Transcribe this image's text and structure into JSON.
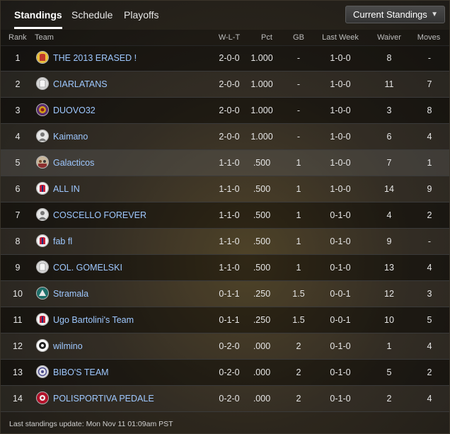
{
  "tabs": [
    {
      "label": "Standings"
    },
    {
      "label": "Schedule"
    },
    {
      "label": "Playoffs"
    }
  ],
  "view_select": {
    "selected": "Current Standings"
  },
  "columns": {
    "rank": "Rank",
    "team": "Team",
    "wlt": "W-L-T",
    "pct": "Pct",
    "gb": "GB",
    "last_week": "Last Week",
    "waiver": "Waiver",
    "moves": "Moves"
  },
  "rows": [
    {
      "rank": "1",
      "team": "THE 2013 ERASED !",
      "wlt": "2-0-0",
      "pct": "1.000",
      "gb": "-",
      "last_week": "1-0-0",
      "waiver": "8",
      "moves": "-",
      "avatar": "jersey-yellow"
    },
    {
      "rank": "2",
      "team": "CIARLATANS",
      "wlt": "2-0-0",
      "pct": "1.000",
      "gb": "-",
      "last_week": "1-0-0",
      "waiver": "11",
      "moves": "7",
      "avatar": "jersey-white"
    },
    {
      "rank": "3",
      "team": "DUOVO32",
      "wlt": "2-0-0",
      "pct": "1.000",
      "gb": "-",
      "last_week": "1-0-0",
      "waiver": "3",
      "moves": "8",
      "avatar": "logo-purple"
    },
    {
      "rank": "4",
      "team": "Kaimano",
      "wlt": "2-0-0",
      "pct": "1.000",
      "gb": "-",
      "last_week": "1-0-0",
      "waiver": "6",
      "moves": "4",
      "avatar": "default-user"
    },
    {
      "rank": "5",
      "team": "Galacticos",
      "wlt": "1-1-0",
      "pct": ".500",
      "gb": "1",
      "last_week": "1-0-0",
      "waiver": "7",
      "moves": "1",
      "avatar": "team-photo"
    },
    {
      "rank": "6",
      "team": "ALL IN",
      "wlt": "1-1-0",
      "pct": ".500",
      "gb": "1",
      "last_week": "1-0-0",
      "waiver": "14",
      "moves": "9",
      "avatar": "jersey-red"
    },
    {
      "rank": "7",
      "team": "COSCELLO FOREVER",
      "wlt": "1-1-0",
      "pct": ".500",
      "gb": "1",
      "last_week": "0-1-0",
      "waiver": "4",
      "moves": "2",
      "avatar": "default-user"
    },
    {
      "rank": "8",
      "team": "fab fl",
      "wlt": "1-1-0",
      "pct": ".500",
      "gb": "1",
      "last_week": "0-1-0",
      "waiver": "9",
      "moves": "-",
      "avatar": "jersey-red"
    },
    {
      "rank": "9",
      "team": "COL. GOMELSKI",
      "wlt": "1-1-0",
      "pct": ".500",
      "gb": "1",
      "last_week": "0-1-0",
      "waiver": "13",
      "moves": "4",
      "avatar": "jersey-white"
    },
    {
      "rank": "10",
      "team": "Stramala",
      "wlt": "0-1-1",
      "pct": ".250",
      "gb": "1.5",
      "last_week": "0-0-1",
      "waiver": "12",
      "moves": "3",
      "avatar": "logo-teal"
    },
    {
      "rank": "11",
      "team": "Ugo Bartolini's Team",
      "wlt": "0-1-1",
      "pct": ".250",
      "gb": "1.5",
      "last_week": "0-0-1",
      "waiver": "10",
      "moves": "5",
      "avatar": "jersey-red"
    },
    {
      "rank": "12",
      "team": "wilmino",
      "wlt": "0-2-0",
      "pct": ".000",
      "gb": "2",
      "last_week": "0-1-0",
      "waiver": "1",
      "moves": "4",
      "avatar": "logo-bw"
    },
    {
      "rank": "13",
      "team": "BIBO'S TEAM",
      "wlt": "0-2-0",
      "pct": ".000",
      "gb": "2",
      "last_week": "0-1-0",
      "waiver": "5",
      "moves": "2",
      "avatar": "logo-badge"
    },
    {
      "rank": "14",
      "team": "POLISPORTIVA PEDALE",
      "wlt": "0-2-0",
      "pct": ".000",
      "gb": "2",
      "last_week": "0-1-0",
      "waiver": "2",
      "moves": "4",
      "avatar": "logo-red"
    }
  ],
  "highlighted_row": 4,
  "footer": {
    "text": "Last standings update: Mon Nov 11 01:09am PST"
  },
  "colors": {
    "link": "#9ec8ff",
    "accent": "#ffffff"
  }
}
